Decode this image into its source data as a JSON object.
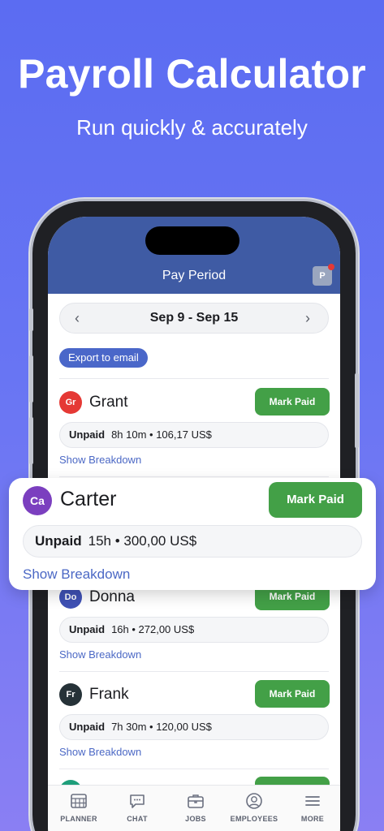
{
  "hero": {
    "title": "Payroll Calculator",
    "subtitle": "Run quickly & accurately"
  },
  "header": {
    "title": "Pay Period",
    "avatar_letter": "P"
  },
  "period": {
    "label": "Sep 9 - Sep 15",
    "prev": "‹",
    "next": "›"
  },
  "export_label": "Export to email",
  "employees": [
    {
      "initials": "Gr",
      "name": "Grant",
      "status": "Unpaid",
      "summary": "8h 10m • 106,17 US$",
      "color": "#e53935"
    },
    {
      "initials": "Ca",
      "name": "Carter",
      "status": "Unpaid",
      "summary": "15h • 300,00 US$",
      "color": "#7b3fbf"
    },
    {
      "initials": "Do",
      "name": "Donna",
      "status": "Unpaid",
      "summary": "16h • 272,00 US$",
      "color": "#3f51b5"
    },
    {
      "initials": "Fr",
      "name": "Frank",
      "status": "Unpaid",
      "summary": "7h 30m • 120,00 US$",
      "color": "#263238"
    }
  ],
  "actions": {
    "mark_paid": "Mark Paid",
    "show_breakdown": "Show Breakdown"
  },
  "tabs": [
    {
      "label": "PLANNER",
      "icon": "planner-icon"
    },
    {
      "label": "CHAT",
      "icon": "chat-icon"
    },
    {
      "label": "JOBS",
      "icon": "jobs-icon"
    },
    {
      "label": "EMPLOYEES",
      "icon": "employees-icon"
    },
    {
      "label": "MORE",
      "icon": "more-icon"
    }
  ],
  "colors": {
    "header": "#3f5ba4",
    "accent": "#4a67c9",
    "paid_button": "#43a047",
    "background": "#5b6cf2"
  }
}
